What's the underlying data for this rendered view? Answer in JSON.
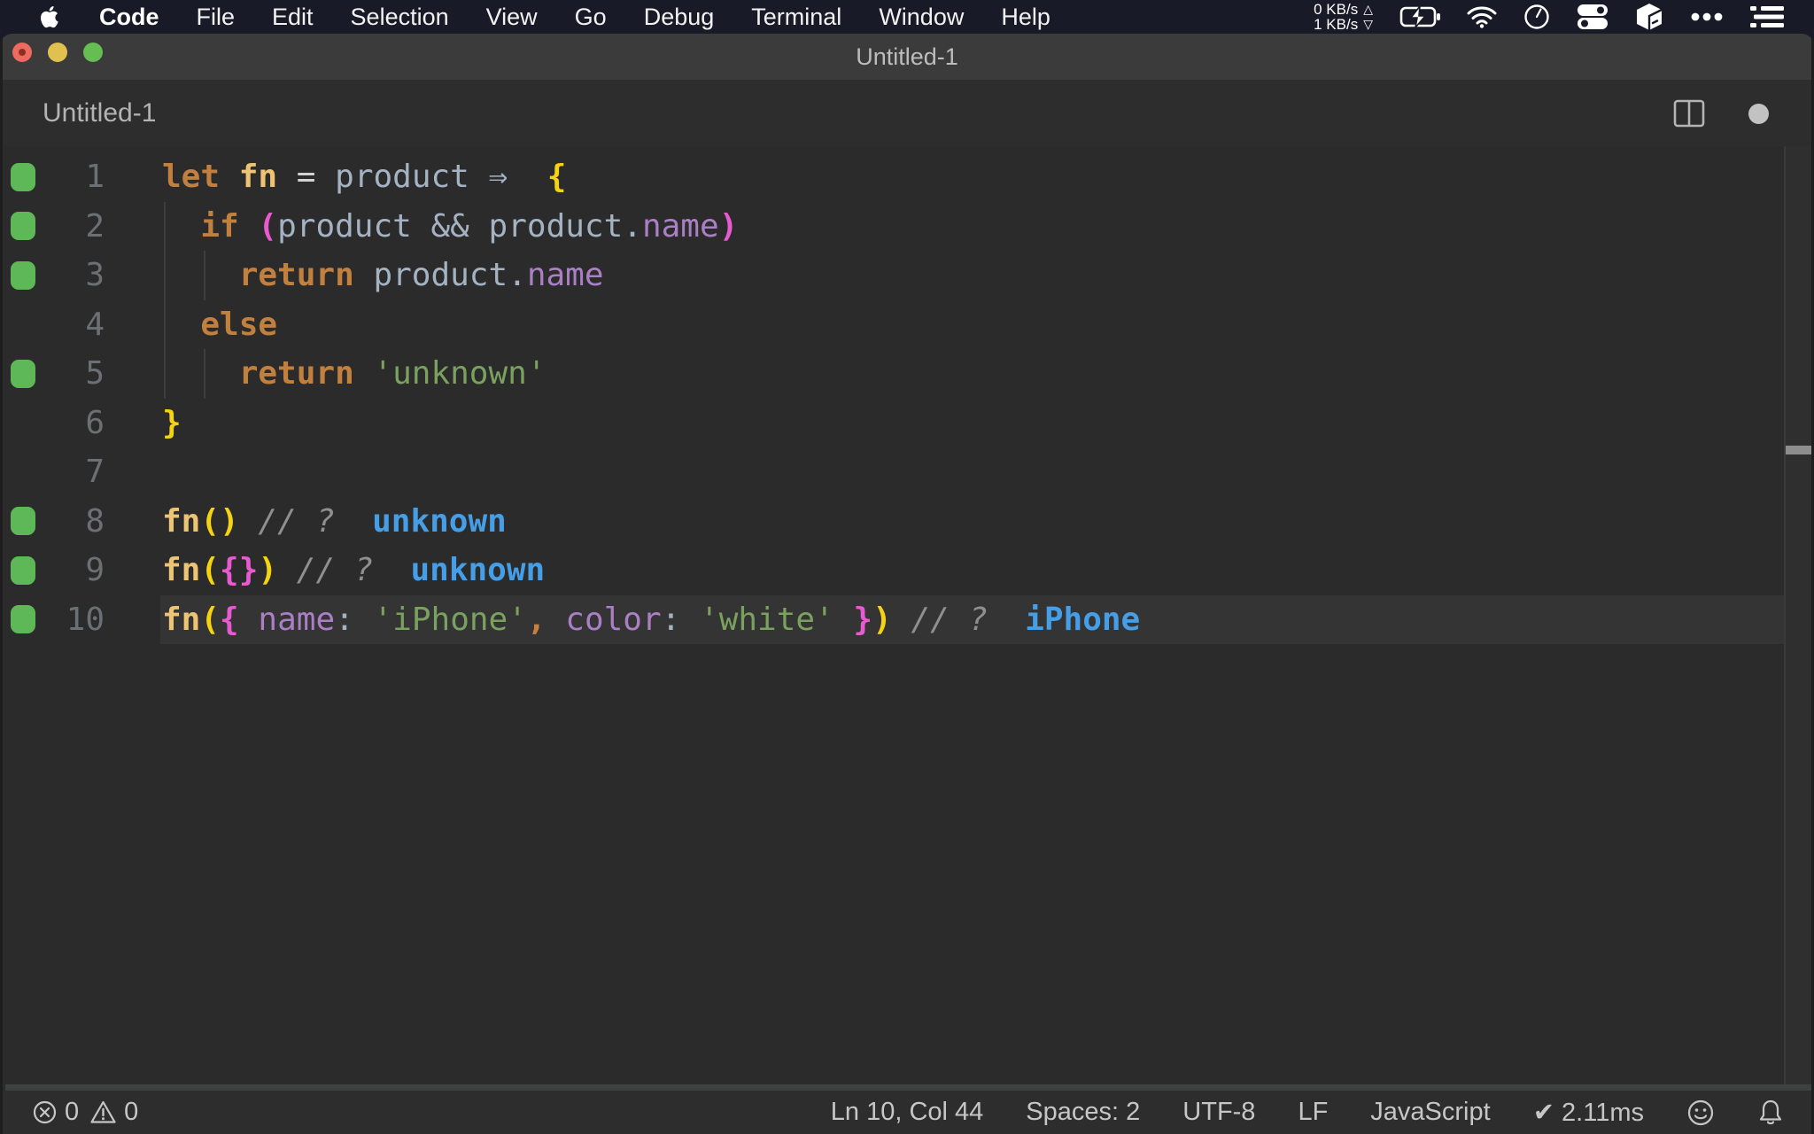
{
  "menu_bar": {
    "app_menu": "Code",
    "items": [
      "File",
      "Edit",
      "Selection",
      "View",
      "Go",
      "Debug",
      "Terminal",
      "Window",
      "Help"
    ],
    "network": {
      "up": "0 KB/s",
      "down": "1 KB/s",
      "up_arrow": "△",
      "down_arrow": "▽"
    },
    "status_icons": [
      "battery-charging-icon",
      "wifi-icon",
      "clock-icon",
      "toggles-icon",
      "cube-icon",
      "more-dots-icon",
      "list-icon"
    ]
  },
  "window": {
    "title": "Untitled-1",
    "tab_label": "Untitled-1",
    "dirty": true
  },
  "editor": {
    "language": "javascript",
    "lines": [
      {
        "num": "1",
        "covered": true,
        "guides": [],
        "tokens": [
          [
            "kw",
            "let"
          ],
          [
            "pl",
            " "
          ],
          [
            "fn",
            "fn"
          ],
          [
            "pl",
            " "
          ],
          [
            "eq",
            "="
          ],
          [
            "pl",
            " "
          ],
          [
            "var",
            "product"
          ],
          [
            "pl",
            " "
          ],
          [
            "arrow",
            "⇒"
          ],
          [
            "pl",
            " "
          ],
          [
            "b1",
            "{"
          ]
        ]
      },
      {
        "num": "2",
        "covered": true,
        "guides": [
          0
        ],
        "tokens": [
          [
            "pl",
            "  "
          ],
          [
            "kw",
            "if"
          ],
          [
            "pl",
            " "
          ],
          [
            "b2",
            "("
          ],
          [
            "var",
            "product"
          ],
          [
            "pl",
            " "
          ],
          [
            "var",
            "&&"
          ],
          [
            "pl",
            " "
          ],
          [
            "var",
            "product."
          ],
          [
            "prop",
            "name"
          ],
          [
            "b2",
            ")"
          ]
        ]
      },
      {
        "num": "3",
        "covered": true,
        "guides": [
          0,
          1
        ],
        "tokens": [
          [
            "pl",
            "    "
          ],
          [
            "kw",
            "return"
          ],
          [
            "pl",
            " "
          ],
          [
            "var",
            "product."
          ],
          [
            "prop",
            "name"
          ]
        ]
      },
      {
        "num": "4",
        "covered": false,
        "guides": [
          0
        ],
        "tokens": [
          [
            "pl",
            "  "
          ],
          [
            "kw",
            "else"
          ]
        ]
      },
      {
        "num": "5",
        "covered": true,
        "guides": [
          0,
          1
        ],
        "tokens": [
          [
            "pl",
            "    "
          ],
          [
            "kw",
            "return"
          ],
          [
            "pl",
            " "
          ],
          [
            "str",
            "'unknown'"
          ]
        ]
      },
      {
        "num": "6",
        "covered": false,
        "guides": [],
        "tokens": [
          [
            "b1",
            "}"
          ]
        ]
      },
      {
        "num": "7",
        "covered": false,
        "guides": [],
        "tokens": []
      },
      {
        "num": "8",
        "covered": true,
        "guides": [],
        "tokens": [
          [
            "fn",
            "fn"
          ],
          [
            "b1",
            "()"
          ],
          [
            "pl",
            " "
          ],
          [
            "cmt",
            "// ?"
          ]
        ],
        "result": "unknown"
      },
      {
        "num": "9",
        "covered": true,
        "guides": [],
        "tokens": [
          [
            "fn",
            "fn"
          ],
          [
            "b1",
            "("
          ],
          [
            "b2",
            "{}"
          ],
          [
            "b1",
            ")"
          ],
          [
            "pl",
            " "
          ],
          [
            "cmt",
            "// ?"
          ]
        ],
        "result": "unknown"
      },
      {
        "num": "10",
        "covered": true,
        "guides": [],
        "current": true,
        "tokens": [
          [
            "fn",
            "fn"
          ],
          [
            "b1",
            "("
          ],
          [
            "b2",
            "{"
          ],
          [
            "pl",
            " "
          ],
          [
            "prop",
            "name"
          ],
          [
            "var",
            ":"
          ],
          [
            "pl",
            " "
          ],
          [
            "str",
            "'iPhone'"
          ],
          [
            "comma",
            ","
          ],
          [
            "pl",
            " "
          ],
          [
            "prop",
            "color"
          ],
          [
            "var",
            ":"
          ],
          [
            "pl",
            " "
          ],
          [
            "str",
            "'white'"
          ],
          [
            "pl",
            " "
          ],
          [
            "b2",
            "}"
          ],
          [
            "b1",
            ")"
          ],
          [
            "pl",
            " "
          ],
          [
            "cmt",
            "// ?"
          ]
        ],
        "result": "iPhone"
      }
    ]
  },
  "status_bar": {
    "errors": "0",
    "warnings": "0",
    "right_items": [
      {
        "name": "cursor-position",
        "text": "Ln 10, Col 44"
      },
      {
        "name": "indentation",
        "text": "Spaces: 2"
      },
      {
        "name": "encoding",
        "text": "UTF-8"
      },
      {
        "name": "eol",
        "text": "LF"
      },
      {
        "name": "language-mode",
        "text": "JavaScript"
      },
      {
        "name": "quokka-time",
        "text": "✔ 2.11ms"
      }
    ]
  },
  "colors": {
    "menubar_bg": "#181b27",
    "titlebar_bg": "#3b3b3b",
    "editor_bg": "#2b2b2b",
    "coverage_green": "#5fb857",
    "keyword": "#c2803e",
    "function": "#ecc474",
    "variable": "#a5b2c2",
    "bracket_l1": "#f5d313",
    "bracket_l2": "#e85ad0",
    "property": "#aa7fc4",
    "string": "#7aa25e",
    "comment": "#8f8f8f",
    "inline_result": "#459ee6",
    "traffic_red": "#ec6a5e",
    "traffic_yellow": "#e0c04e",
    "traffic_green": "#66bd51"
  }
}
